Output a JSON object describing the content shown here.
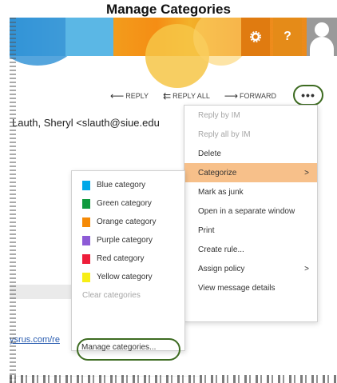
{
  "doc_title": "Manage Categories",
  "header": {
    "gear_icon": "gear-icon",
    "help_label": "?",
    "user_icon": "user-avatar-icon"
  },
  "actions": {
    "reply": "REPLY",
    "reply_all": "REPLY ALL",
    "forward": "FORWARD",
    "more_label": "•••"
  },
  "message": {
    "sender": "Lauth, Sheryl <slauth@siue.edu",
    "link_fragment": "ysrus.com/re"
  },
  "context_menu": {
    "items": [
      {
        "label": "Reply by IM",
        "disabled": true,
        "submenu": false
      },
      {
        "label": "Reply all by IM",
        "disabled": true,
        "submenu": false
      },
      {
        "label": "Delete",
        "disabled": false,
        "submenu": false
      },
      {
        "label": "Categorize",
        "disabled": false,
        "submenu": true,
        "active": true
      },
      {
        "label": "Mark as junk",
        "disabled": false,
        "submenu": false
      },
      {
        "label": "Open in a separate window",
        "disabled": false,
        "submenu": false
      },
      {
        "label": "Print",
        "disabled": false,
        "submenu": false
      },
      {
        "label": "Create rule...",
        "disabled": false,
        "submenu": false
      },
      {
        "label": "Assign policy",
        "disabled": false,
        "submenu": true
      },
      {
        "label": "View message details",
        "disabled": false,
        "submenu": false
      }
    ],
    "chevron": ">"
  },
  "categorize_submenu": {
    "categories": [
      {
        "label": "Blue category",
        "color": "#00a8e8"
      },
      {
        "label": "Green category",
        "color": "#109a3e"
      },
      {
        "label": "Orange category",
        "color": "#f58a06"
      },
      {
        "label": "Purple category",
        "color": "#8d5bd6"
      },
      {
        "label": "Red category",
        "color": "#ee1d3a"
      },
      {
        "label": "Yellow category",
        "color": "#f7ee16"
      }
    ],
    "clear_label": "Clear categories",
    "manage_label": "Manage categories..."
  },
  "colors": {
    "highlight": "#f7c08a",
    "ring": "#3d6b21"
  }
}
